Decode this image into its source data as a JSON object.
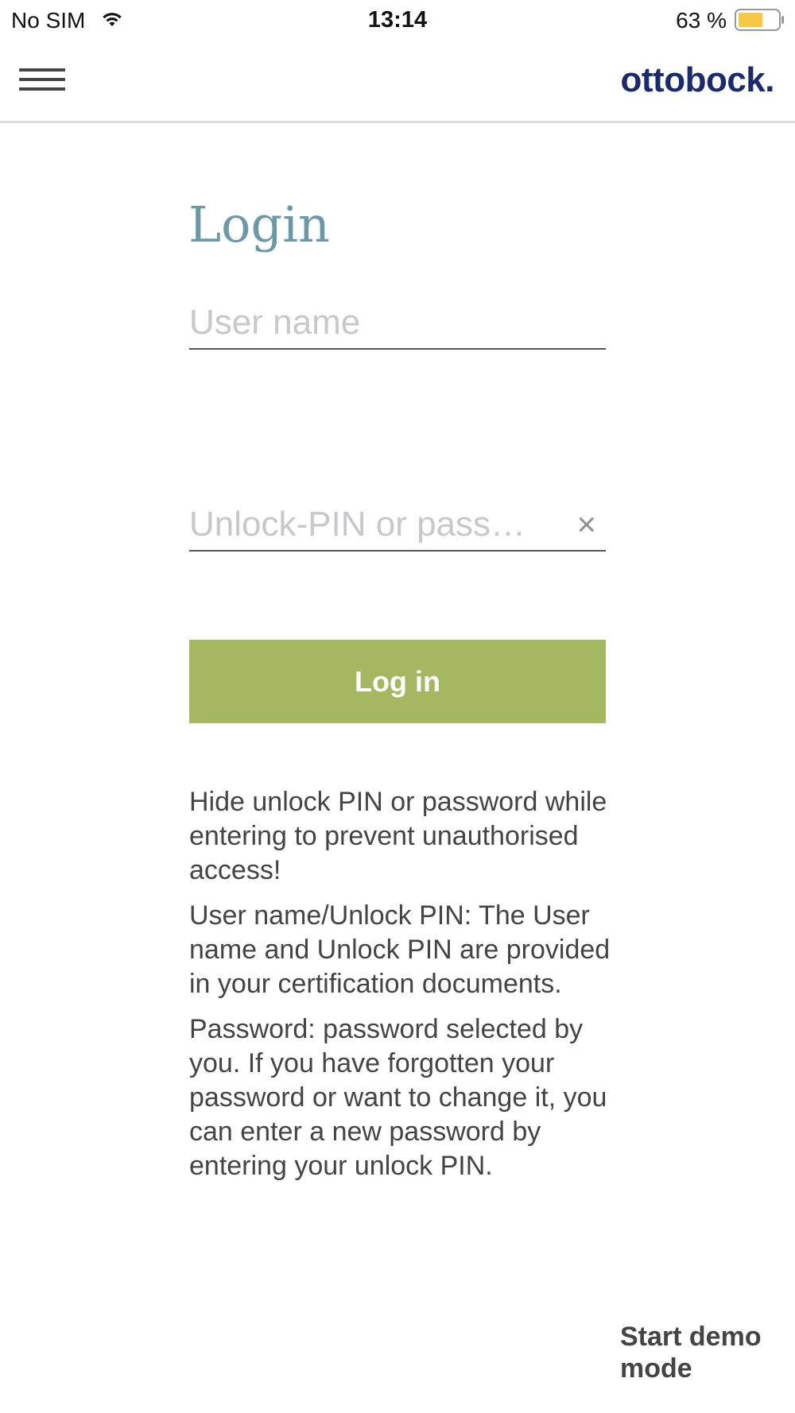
{
  "status_bar": {
    "carrier": "No SIM",
    "time": "13:14",
    "battery_percent": "63 %",
    "battery_level": 0.63,
    "battery_color": "#f7c844",
    "wifi_icon": "wifi-icon",
    "battery_icon": "battery-icon"
  },
  "header": {
    "menu_icon": "hamburger-menu-icon",
    "logo_text": "ottobock.",
    "logo_color": "#1a2b6d"
  },
  "login": {
    "title": "Login",
    "title_color": "#6b9aa6",
    "username": {
      "value": "",
      "placeholder": "User name"
    },
    "password": {
      "value": "",
      "placeholder": "Unlock-PIN or pass…",
      "clear_icon": "×"
    },
    "submit_label": "Log in",
    "submit_color": "#a4b862"
  },
  "help": {
    "paragraph1": "Hide unlock PIN or password while entering to prevent unauthorised access!",
    "paragraph2": "User name/Unlock PIN: The User name and Unlock PIN are provided in your certification documents.",
    "paragraph3": "Password: password selected by you. If you have forgotten your password or want to change it, you can enter a new password by entering your unlock PIN."
  },
  "demo": {
    "label": "Start demo mode"
  }
}
